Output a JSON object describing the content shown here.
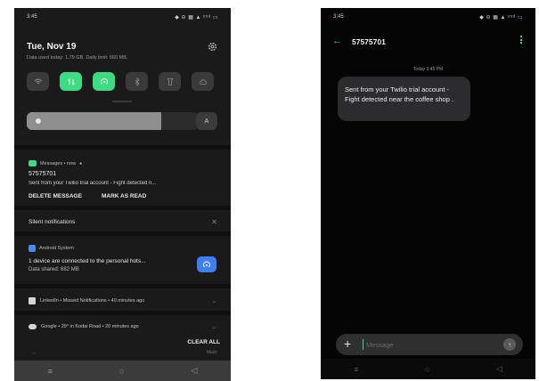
{
  "left": {
    "status": {
      "time": "3:45",
      "icons": "◆ ⊖ ▦ ▲ ᵒ⁵ᵈ ▭"
    },
    "date": "Tue, Nov 19",
    "usage": "Data used today: 1.79 GB. Daily limit: 560 MB.",
    "tiles": [
      {
        "name": "wifi",
        "icon": "wifi-icon",
        "on": false
      },
      {
        "name": "mobile-data",
        "icon": "data-arrows-icon",
        "on": true
      },
      {
        "name": "hotspot",
        "icon": "hotspot-icon",
        "on": true
      },
      {
        "name": "bluetooth",
        "icon": "bluetooth-icon",
        "on": false
      },
      {
        "name": "flashlight",
        "icon": "flashlight-icon",
        "on": false
      },
      {
        "name": "cloud",
        "icon": "cloud-icon",
        "on": false
      }
    ],
    "brightness": {
      "level": 0.78,
      "auto_label": "A"
    },
    "message_notification": {
      "app": "Messages • now",
      "sender": "57575701",
      "text": "Sent from your Twilio trial account - Fight detected n...",
      "actions": [
        "DELETE MESSAGE",
        "MARK AS READ"
      ]
    },
    "silent_header": "Silent notifications",
    "system_notification": {
      "app": "Android System",
      "line1": "1 device are connected to the personal hots...",
      "line2": "Data shared: 682 MB"
    },
    "rows": [
      {
        "text": "LinkedIn • Missed Notifications • 40 minutes ago"
      },
      {
        "text": "Google • 29° in Kodai Road • 20 minutes ago"
      }
    ],
    "clear_all": "CLEAR ALL",
    "dim_row": "Muzlr",
    "nav": [
      "≡",
      "○",
      "◁"
    ]
  },
  "right": {
    "status": {
      "time": "3:45",
      "icons": "◆ ⊖ ▦ ▲ ᵒ⁵ᵈ ▭"
    },
    "contact": "57575701",
    "timestamp": "Today 3:45 PM",
    "message": "Sent from your Twilio trial account - Fight detected near the coffee shop .",
    "composer_placeholder": "Message",
    "nav": [
      "≡",
      "○",
      "◁"
    ]
  },
  "colors": {
    "accent": "#3ddc84",
    "hotspot_blue": "#3d7ff0"
  }
}
